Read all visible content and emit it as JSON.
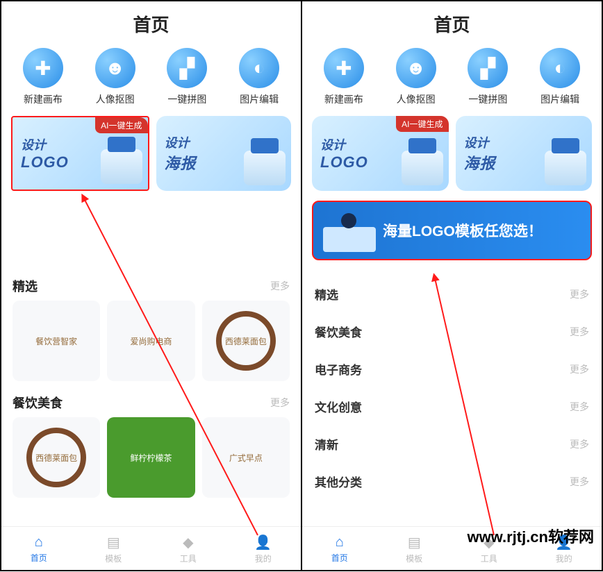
{
  "left": {
    "header": "首页",
    "tools": [
      {
        "label": "新建画布"
      },
      {
        "label": "人像抠图"
      },
      {
        "label": "一键拼图"
      },
      {
        "label": "图片编辑"
      }
    ],
    "cards": {
      "logo": {
        "line1": "设计",
        "line2": "LOGO",
        "badge": "AI一键生成"
      },
      "poster": {
        "line1": "设计",
        "line2": "海报"
      }
    },
    "sections": [
      {
        "title": "精选",
        "more": "更多",
        "thumbs": [
          {
            "text": "餐饮营智家"
          },
          {
            "text": "爱尚购电商"
          },
          {
            "text": "西德莱面包"
          }
        ]
      },
      {
        "title": "餐饮美食",
        "more": "更多",
        "thumbs": [
          {
            "text": "西德莱面包"
          },
          {
            "text": "鲜柠柠檬茶"
          },
          {
            "text": "广式早点"
          }
        ]
      }
    ],
    "tabs": [
      {
        "label": "首页"
      },
      {
        "label": "模板"
      },
      {
        "label": "工具"
      },
      {
        "label": "我的"
      }
    ]
  },
  "right": {
    "header": "首页",
    "tools": [
      {
        "label": "新建画布"
      },
      {
        "label": "人像抠图"
      },
      {
        "label": "一键拼图"
      },
      {
        "label": "图片编辑"
      }
    ],
    "cards": {
      "logo": {
        "line1": "设计",
        "line2": "LOGO",
        "badge": "AI一键生成"
      },
      "poster": {
        "line1": "设计",
        "line2": "海报"
      }
    },
    "midbanner": "海量LOGO模板任您选！",
    "categories": [
      {
        "label": "精选",
        "more": "更多"
      },
      {
        "label": "餐饮美食",
        "more": "更多"
      },
      {
        "label": "电子商务",
        "more": "更多"
      },
      {
        "label": "文化创意",
        "more": "更多"
      },
      {
        "label": "清新",
        "more": "更多"
      },
      {
        "label": "其他分类",
        "more": "更多"
      }
    ],
    "tabs": [
      {
        "label": "首页"
      },
      {
        "label": "模板"
      },
      {
        "label": "工具"
      },
      {
        "label": "我的"
      }
    ]
  },
  "watermark": "www.rjtj.cn软荐网"
}
